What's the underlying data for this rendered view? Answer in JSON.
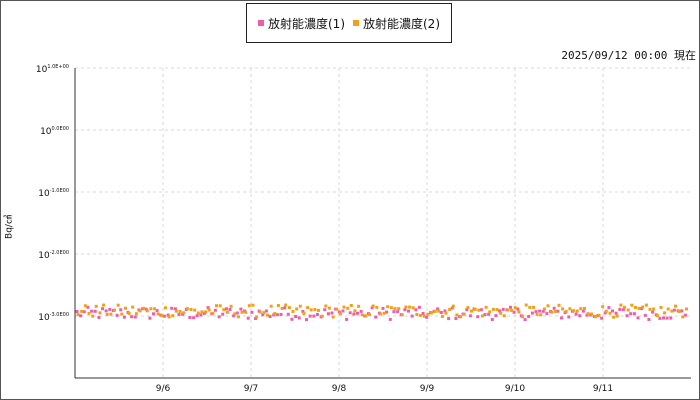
{
  "legend": {
    "series1_label": "放射能濃度(1)",
    "series2_label": "放射能濃度(2)"
  },
  "timestamp": "2025/09/12 00:00 現在",
  "chart_data": {
    "type": "scatter",
    "title": "",
    "ylabel": "Bq/㎤",
    "yscale": "log",
    "ylim": [
      0.0001,
      10
    ],
    "yticks": [
      {
        "value": 10,
        "base": "10",
        "exp": "1.0E+00"
      },
      {
        "value": 1,
        "base": "10",
        "exp": "0.0E00"
      },
      {
        "value": 0.1,
        "base": "10",
        "exp": "-1.0E00"
      },
      {
        "value": 0.01,
        "base": "10",
        "exp": "-2.0E00"
      },
      {
        "value": 0.001,
        "base": "10",
        "exp": "-3.0E00"
      }
    ],
    "xlim": [
      "9/5",
      "9/12"
    ],
    "xticks": [
      "9/6",
      "9/7",
      "9/8",
      "9/9",
      "9/10",
      "9/11"
    ],
    "grid": true,
    "legend_position": "top-center",
    "series": [
      {
        "name": "放射能濃度(1)",
        "color": "#ee5ea8",
        "typical_value": 0.0011,
        "range": [
          0.0009,
          0.0015
        ]
      },
      {
        "name": "放射能濃度(2)",
        "color": "#f0a01a",
        "typical_value": 0.0012,
        "range": [
          0.0009,
          0.0015
        ]
      }
    ]
  }
}
